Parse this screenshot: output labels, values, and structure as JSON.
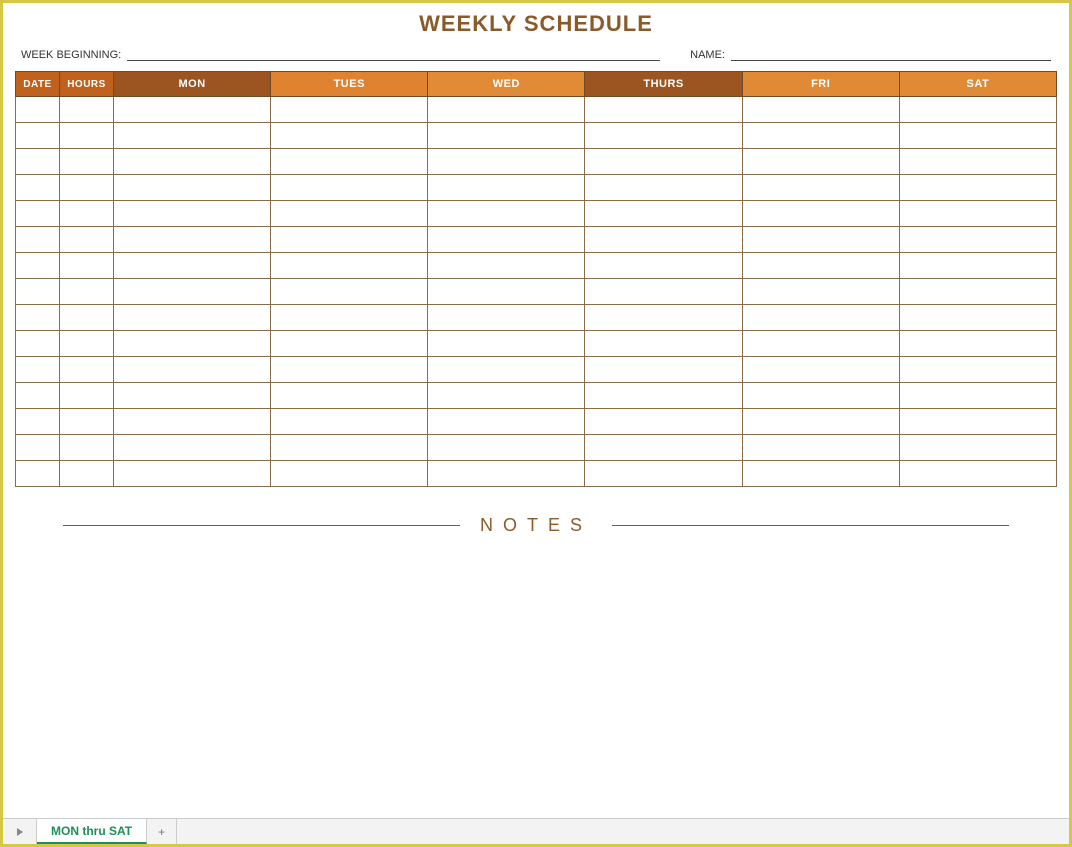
{
  "title": "WEEKLY SCHEDULE",
  "meta": {
    "week_beginning_label": "WEEK BEGINNING:",
    "week_beginning_value": "",
    "name_label": "NAME:",
    "name_value": ""
  },
  "columns": {
    "date": "DATE",
    "hours": "HOURS",
    "mon": "MON",
    "tues": "TUES",
    "wed": "WED",
    "thurs": "THURS",
    "fri": "FRI",
    "sat": "SAT"
  },
  "rows": [
    {
      "date": "",
      "hours": "",
      "mon": "",
      "tues": "",
      "wed": "",
      "thurs": "",
      "fri": "",
      "sat": ""
    },
    {
      "date": "",
      "hours": "",
      "mon": "",
      "tues": "",
      "wed": "",
      "thurs": "",
      "fri": "",
      "sat": ""
    },
    {
      "date": "",
      "hours": "",
      "mon": "",
      "tues": "",
      "wed": "",
      "thurs": "",
      "fri": "",
      "sat": ""
    },
    {
      "date": "",
      "hours": "",
      "mon": "",
      "tues": "",
      "wed": "",
      "thurs": "",
      "fri": "",
      "sat": ""
    },
    {
      "date": "",
      "hours": "",
      "mon": "",
      "tues": "",
      "wed": "",
      "thurs": "",
      "fri": "",
      "sat": ""
    },
    {
      "date": "",
      "hours": "",
      "mon": "",
      "tues": "",
      "wed": "",
      "thurs": "",
      "fri": "",
      "sat": ""
    },
    {
      "date": "",
      "hours": "",
      "mon": "",
      "tues": "",
      "wed": "",
      "thurs": "",
      "fri": "",
      "sat": ""
    },
    {
      "date": "",
      "hours": "",
      "mon": "",
      "tues": "",
      "wed": "",
      "thurs": "",
      "fri": "",
      "sat": ""
    },
    {
      "date": "",
      "hours": "",
      "mon": "",
      "tues": "",
      "wed": "",
      "thurs": "",
      "fri": "",
      "sat": ""
    },
    {
      "date": "",
      "hours": "",
      "mon": "",
      "tues": "",
      "wed": "",
      "thurs": "",
      "fri": "",
      "sat": ""
    },
    {
      "date": "",
      "hours": "",
      "mon": "",
      "tues": "",
      "wed": "",
      "thurs": "",
      "fri": "",
      "sat": ""
    },
    {
      "date": "",
      "hours": "",
      "mon": "",
      "tues": "",
      "wed": "",
      "thurs": "",
      "fri": "",
      "sat": ""
    },
    {
      "date": "",
      "hours": "",
      "mon": "",
      "tues": "",
      "wed": "",
      "thurs": "",
      "fri": "",
      "sat": ""
    },
    {
      "date": "",
      "hours": "",
      "mon": "",
      "tues": "",
      "wed": "",
      "thurs": "",
      "fri": "",
      "sat": ""
    },
    {
      "date": "",
      "hours": "",
      "mon": "",
      "tues": "",
      "wed": "",
      "thurs": "",
      "fri": "",
      "sat": ""
    }
  ],
  "notes_title": "NOTES",
  "notes_body": "",
  "tabs": {
    "sheet1": "MON thru SAT",
    "add_glyph": "+"
  }
}
